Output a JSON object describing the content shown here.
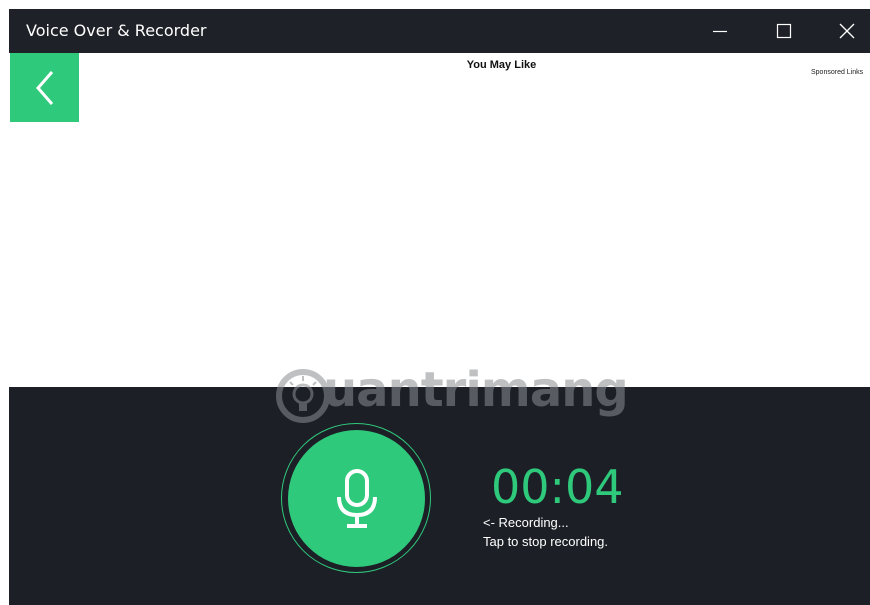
{
  "window": {
    "title": "Voice Over & Recorder",
    "controls": {
      "minimize_icon": "minimize-icon",
      "maximize_icon": "maximize-icon",
      "close_icon": "close-icon"
    }
  },
  "ad": {
    "heading": "You May Like",
    "sponsored": "Sponsored Links",
    "back_icon": "chevron-left-icon"
  },
  "recorder": {
    "timer": "00:04",
    "status_line_1": "<- Recording...",
    "status_line_2": "Tap to stop recording.",
    "mic_icon": "microphone-icon",
    "watermark": "uantrimang"
  },
  "colors": {
    "accent": "#2fc97c",
    "panel": "#1c1f26",
    "titlebar": "#1f2128"
  }
}
